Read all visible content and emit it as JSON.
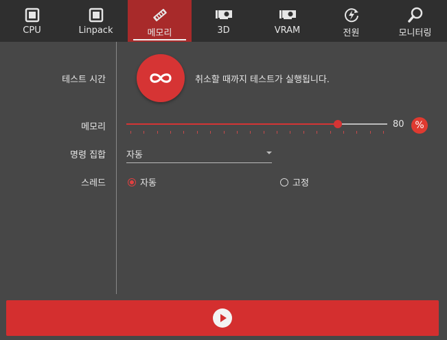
{
  "tabs": [
    {
      "label": "CPU",
      "icon": "cpu-chip-icon",
      "active": false
    },
    {
      "label": "Linpack",
      "icon": "linpack-chip-icon",
      "active": false
    },
    {
      "label": "메모리",
      "icon": "memory-stick-icon",
      "active": true
    },
    {
      "label": "3D",
      "icon": "gpu-card-icon",
      "active": false
    },
    {
      "label": "VRAM",
      "icon": "vram-card-icon",
      "active": false
    },
    {
      "label": "전원",
      "icon": "power-cycle-icon",
      "active": false
    },
    {
      "label": "모니터링",
      "icon": "magnifier-icon",
      "active": false
    }
  ],
  "test_time": {
    "label": "테스트 시간",
    "description": "취소할 때까지 테스트가 실행됩니다.",
    "icon": "infinity-icon"
  },
  "memory": {
    "label": "메모리",
    "value": "80",
    "fraction": 0.8,
    "unit": "%"
  },
  "instruction_set": {
    "label": "명령 집합",
    "selected": "자동"
  },
  "threads": {
    "label": "스레드",
    "options": [
      {
        "label": "자동",
        "checked": true
      },
      {
        "label": "고정",
        "checked": false
      }
    ]
  },
  "start_button": {
    "icon": "play-icon"
  },
  "colors": {
    "accent": "#d63434",
    "active_tab": "#a82a2a",
    "background": "#474747",
    "tabbar": "#2f2f2f"
  }
}
